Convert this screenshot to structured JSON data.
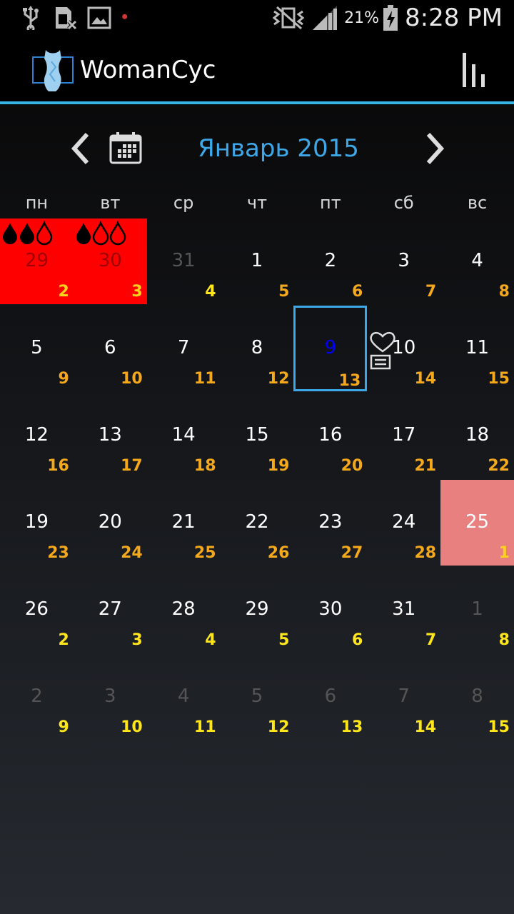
{
  "status_bar": {
    "battery_percent": "21%",
    "time": "8:28 PM",
    "icons": [
      "usb-icon",
      "sim-card-icon",
      "image-icon",
      "notification-dot-icon",
      "vibrate-mute-icon",
      "signal-icon",
      "battery-charging-icon"
    ]
  },
  "action_bar": {
    "title": "WomanCyc",
    "icons": [
      "app-logo-icon",
      "stats-bar-chart-icon"
    ]
  },
  "calendar": {
    "month_title": "Январь 2015",
    "weekdays": [
      "пн",
      "вт",
      "ср",
      "чт",
      "пт",
      "сб",
      "вс"
    ],
    "weeks": [
      [
        {
          "day": "29",
          "cycle": "2",
          "state": "period",
          "other_month": true,
          "drops": 2
        },
        {
          "day": "30",
          "cycle": "3",
          "state": "period",
          "other_month": true,
          "drops": 1
        },
        {
          "day": "31",
          "cycle": "4",
          "other_month": true
        },
        {
          "day": "1",
          "cycle": "5"
        },
        {
          "day": "2",
          "cycle": "6"
        },
        {
          "day": "3",
          "cycle": "7"
        },
        {
          "day": "4",
          "cycle": "8"
        }
      ],
      [
        {
          "day": "5",
          "cycle": "9"
        },
        {
          "day": "6",
          "cycle": "10"
        },
        {
          "day": "7",
          "cycle": "11"
        },
        {
          "day": "8",
          "cycle": "12"
        },
        {
          "day": "9",
          "cycle": "13",
          "state": "today"
        },
        {
          "day": "10",
          "cycle": "14",
          "note": true
        },
        {
          "day": "11",
          "cycle": "15"
        }
      ],
      [
        {
          "day": "12",
          "cycle": "16"
        },
        {
          "day": "13",
          "cycle": "17"
        },
        {
          "day": "14",
          "cycle": "18"
        },
        {
          "day": "15",
          "cycle": "19"
        },
        {
          "day": "16",
          "cycle": "20"
        },
        {
          "day": "17",
          "cycle": "21"
        },
        {
          "day": "18",
          "cycle": "22"
        }
      ],
      [
        {
          "day": "19",
          "cycle": "23"
        },
        {
          "day": "20",
          "cycle": "24"
        },
        {
          "day": "21",
          "cycle": "25"
        },
        {
          "day": "22",
          "cycle": "26"
        },
        {
          "day": "23",
          "cycle": "27"
        },
        {
          "day": "24",
          "cycle": "28"
        },
        {
          "day": "25",
          "cycle": "1",
          "state": "ovul"
        }
      ],
      [
        {
          "day": "26",
          "cycle": "2",
          "yellow": true
        },
        {
          "day": "27",
          "cycle": "3",
          "yellow": true
        },
        {
          "day": "28",
          "cycle": "4",
          "yellow": true
        },
        {
          "day": "29",
          "cycle": "5",
          "yellow": true
        },
        {
          "day": "30",
          "cycle": "6",
          "yellow": true
        },
        {
          "day": "31",
          "cycle": "7",
          "yellow": true
        },
        {
          "day": "1",
          "cycle": "8",
          "other_month": true
        }
      ],
      [
        {
          "day": "2",
          "cycle": "9",
          "other_month": true
        },
        {
          "day": "3",
          "cycle": "10",
          "other_month": true
        },
        {
          "day": "4",
          "cycle": "11",
          "other_month": true
        },
        {
          "day": "5",
          "cycle": "12",
          "other_month": true
        },
        {
          "day": "6",
          "cycle": "13",
          "other_month": true
        },
        {
          "day": "7",
          "cycle": "14",
          "other_month": true
        },
        {
          "day": "8",
          "cycle": "15",
          "other_month": true
        }
      ]
    ]
  },
  "colors": {
    "accent": "#33b5e5",
    "period": "#ff0000",
    "ovulation": "#e98080",
    "cycle_day": "#f4a81c",
    "cycle_day_next": "#ffe51c"
  }
}
